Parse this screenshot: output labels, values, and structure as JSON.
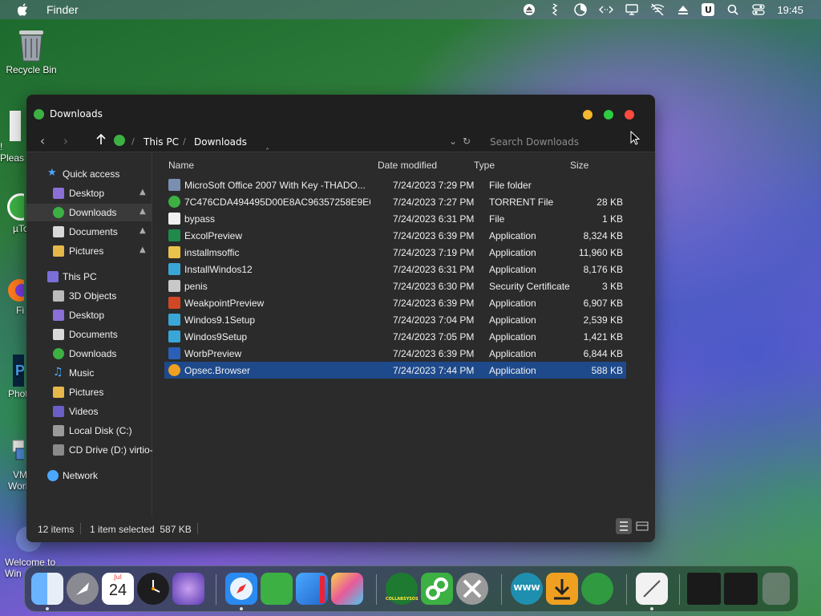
{
  "menubar": {
    "app_name": "Finder",
    "clock": "19:45",
    "u_icon_label": "U"
  },
  "desktop": {
    "icons": [
      {
        "label": "Recycle Bin"
      },
      {
        "label": "! Pleas"
      },
      {
        "label": "µTo"
      },
      {
        "label": "Fi"
      },
      {
        "label": "Phot"
      },
      {
        "label": "VM"
      },
      {
        "label": "Work"
      },
      {
        "label": "Welcome to"
      },
      {
        "label": "Win"
      }
    ]
  },
  "window": {
    "title": "Downloads",
    "breadcrumb": [
      "This PC",
      "Downloads"
    ],
    "search_placeholder": "Search Downloads",
    "columns": {
      "name": "Name",
      "date": "Date modified",
      "type": "Type",
      "size": "Size"
    },
    "sidebar": [
      {
        "label": "Quick access",
        "pinned": false
      },
      {
        "label": "Desktop",
        "pinned": true
      },
      {
        "label": "Downloads",
        "pinned": true
      },
      {
        "label": "Documents",
        "pinned": true
      },
      {
        "label": "Pictures",
        "pinned": true
      },
      {
        "label": "This PC",
        "pinned": false
      },
      {
        "label": "3D Objects",
        "pinned": false
      },
      {
        "label": "Desktop",
        "pinned": false
      },
      {
        "label": "Documents",
        "pinned": false
      },
      {
        "label": "Downloads",
        "pinned": false
      },
      {
        "label": "Music",
        "pinned": false
      },
      {
        "label": "Pictures",
        "pinned": false
      },
      {
        "label": "Videos",
        "pinned": false
      },
      {
        "label": "Local Disk (C:)",
        "pinned": false
      },
      {
        "label": "CD Drive (D:) virtio-",
        "pinned": false
      },
      {
        "label": "Network",
        "pinned": false
      }
    ],
    "files": [
      {
        "name": "MicroSoft Office 2007 With Key -THADO...",
        "date": "7/24/2023 7:29 PM",
        "type": "File folder",
        "size": ""
      },
      {
        "name": "7C476CDA494495D00E8AC96357258E9E6...",
        "date": "7/24/2023 7:27 PM",
        "type": "TORRENT File",
        "size": "28 KB"
      },
      {
        "name": "bypass",
        "date": "7/24/2023 6:31 PM",
        "type": "File",
        "size": "1 KB"
      },
      {
        "name": "ExcolPreview",
        "date": "7/24/2023 6:39 PM",
        "type": "Application",
        "size": "8,324 KB"
      },
      {
        "name": "installmsoffic",
        "date": "7/24/2023 7:19 PM",
        "type": "Application",
        "size": "11,960 KB"
      },
      {
        "name": "InstallWindos12",
        "date": "7/24/2023 6:31 PM",
        "type": "Application",
        "size": "8,176 KB"
      },
      {
        "name": "penis",
        "date": "7/24/2023 6:30 PM",
        "type": "Security Certificate",
        "size": "3 KB"
      },
      {
        "name": "WeakpointPreview",
        "date": "7/24/2023 6:39 PM",
        "type": "Application",
        "size": "6,907 KB"
      },
      {
        "name": "Windos9.1Setup",
        "date": "7/24/2023 7:04 PM",
        "type": "Application",
        "size": "2,539 KB"
      },
      {
        "name": "Windos9Setup",
        "date": "7/24/2023 7:05 PM",
        "type": "Application",
        "size": "1,421 KB"
      },
      {
        "name": "WorbPreview",
        "date": "7/24/2023 6:39 PM",
        "type": "Application",
        "size": "6,844 KB"
      },
      {
        "name": "Opsec.Browser",
        "date": "7/24/2023 7:44 PM",
        "type": "Application",
        "size": "588 KB"
      }
    ],
    "status": {
      "items": "12 items",
      "selected": "1 item selected  587 KB"
    }
  },
  "dock": {
    "calendar_month": "Jul",
    "calendar_day": "24",
    "collabsysos_label": "COLLABSYSOS",
    "www_label": "WWW"
  },
  "colors": {
    "selection": "#1e4a8c",
    "window_bg": "#2b2b2b",
    "titlebar_bg": "#1f1f1f"
  }
}
